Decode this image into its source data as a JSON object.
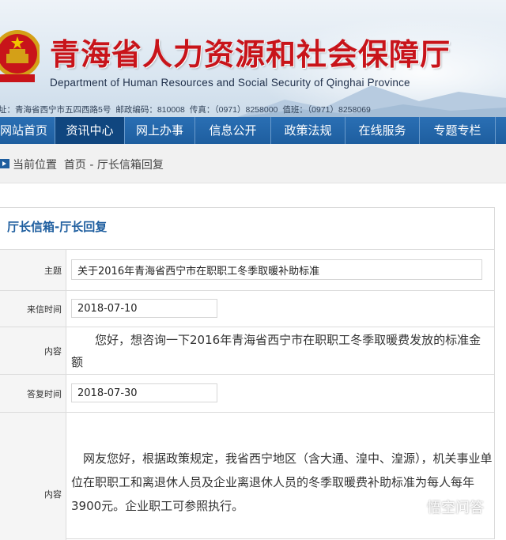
{
  "banner": {
    "title_cn": "青海省人力资源和社会保障厅",
    "title_en": "Department of Human Resources and Social Security of Qinghai Province",
    "contact": {
      "address": "址：青海省西宁市五四西路5号",
      "postcode": "邮政编码：810008",
      "fax": "传真：（0971）8258000",
      "tel": "值班：（0971）8258069"
    }
  },
  "nav": {
    "items": [
      {
        "label": "网站首页",
        "active": false
      },
      {
        "label": "资讯中心",
        "active": true
      },
      {
        "label": "网上办事",
        "active": false
      },
      {
        "label": "信息公开",
        "active": false
      },
      {
        "label": "政策法规",
        "active": false
      },
      {
        "label": "在线服务",
        "active": false
      },
      {
        "label": "专题专栏",
        "active": false
      }
    ]
  },
  "breadcrumb": {
    "text": "当前位置  首页 - 厅长信箱回复"
  },
  "panel": {
    "title": "厅长信箱-厅长回复",
    "rows": {
      "subject": {
        "label": "主题",
        "value": "关于2016年青海省西宁市在职职工冬季取暖补助标准"
      },
      "sent_time": {
        "label": "来信时间",
        "value": "2018-07-10"
      },
      "content": {
        "label": "内容",
        "line1": "　　您好，想咨询一下2016年青海省西宁市在职职工冬季取暖费发放的标准金",
        "line2": "额"
      },
      "reply_time": {
        "label": "答复时间",
        "value": "2018-07-30"
      },
      "reply": {
        "label": "内容",
        "line1": "　网友您好，根据政策规定，我省西宁地区（含大通、湟中、湟源），机关事业单",
        "line2": "位在职职工和离退休人员及企业离退休人员的冬季取暖费补助标准为每人每年",
        "line3": "3900元。企业职工可参照执行。"
      }
    }
  },
  "watermark": {
    "text": "悟空问答"
  },
  "colors": {
    "brand_red": "#c8141a",
    "nav_blue": "#1e5e9f",
    "nav_active": "#10467f"
  }
}
